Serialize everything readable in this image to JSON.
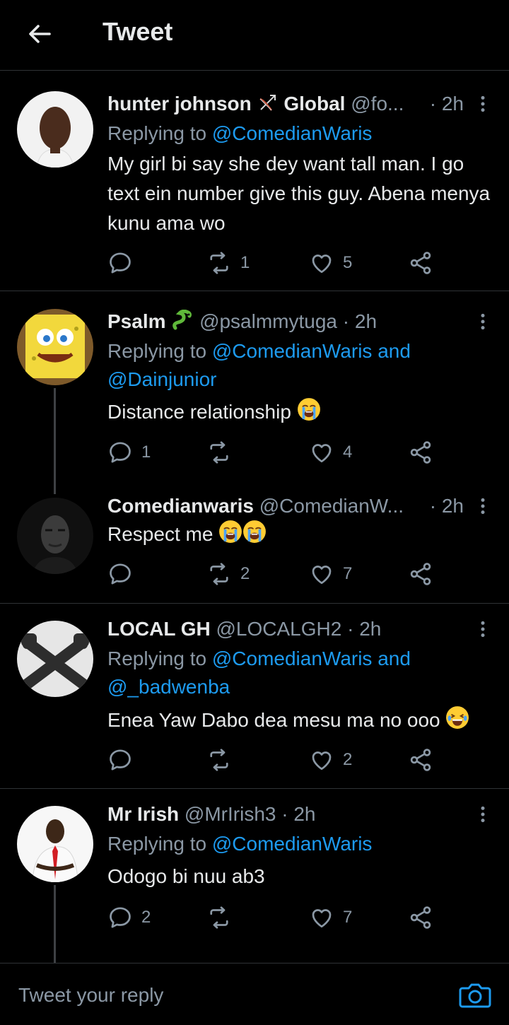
{
  "header": {
    "title": "Tweet",
    "back_icon": "arrow-left-icon"
  },
  "colors": {
    "background": "#000000",
    "link": "#1d9bf0",
    "muted": "#8b98a5",
    "text": "#e7e9ea",
    "divider": "#2f3336"
  },
  "tweets": [
    {
      "name": "hunter johnson",
      "name_suffix": "Global",
      "name_emoji_icon": "bow-and-arrow-icon",
      "handle": "@fo...",
      "time": "· 2h",
      "replying_prefix": "Replying to ",
      "replying_to": "@ComedianWaris",
      "replying_and": "",
      "replying_to2": "",
      "text": "My girl bi say she dey want tall man. I go text ein number give this guy. Abena menya kunu ama wo",
      "reply_count": "",
      "retweet_count": "1",
      "like_count": "5"
    },
    {
      "name": "Psalm",
      "name_emoji_icon": "snake-icon",
      "handle": "@psalmmytuga",
      "time": "· 2h",
      "replying_prefix": "Replying to ",
      "replying_to": "@ComedianWaris",
      "replying_and": " and",
      "replying_to2": "@Dainjunior",
      "text": "Distance relationship",
      "text_emoji_icon": "crying-face-icon",
      "reply_count": "1",
      "retweet_count": "",
      "like_count": "4"
    },
    {
      "name": "Comedianwaris",
      "handle": "@ComedianW...",
      "time": "· 2h",
      "text": "Respect me",
      "text_emoji_icon": "crying-face-icon",
      "reply_count": "",
      "retweet_count": "2",
      "like_count": "7"
    },
    {
      "name": "LOCAL GH",
      "handle": "@LOCALGH2",
      "time": "· 2h",
      "replying_prefix": "Replying to ",
      "replying_to": "@ComedianWaris",
      "replying_and": " and",
      "replying_to2": "@_badwenba",
      "text": "Enea Yaw Dabo dea mesu ma no ooo",
      "text_emoji_icon": "laughing-tears-icon",
      "reply_count": "",
      "retweet_count": "",
      "like_count": "2"
    },
    {
      "name": "Mr Irish",
      "handle": "@MrIrish3",
      "time": "· 2h",
      "replying_prefix": "Replying to ",
      "replying_to": "@ComedianWaris",
      "replying_and": "",
      "replying_to2": "",
      "text": "Odogo bi nuu ab3",
      "reply_count": "2",
      "retweet_count": "",
      "like_count": "7"
    }
  ],
  "reply_bar": {
    "placeholder": "Tweet your reply",
    "camera_icon": "camera-icon"
  }
}
